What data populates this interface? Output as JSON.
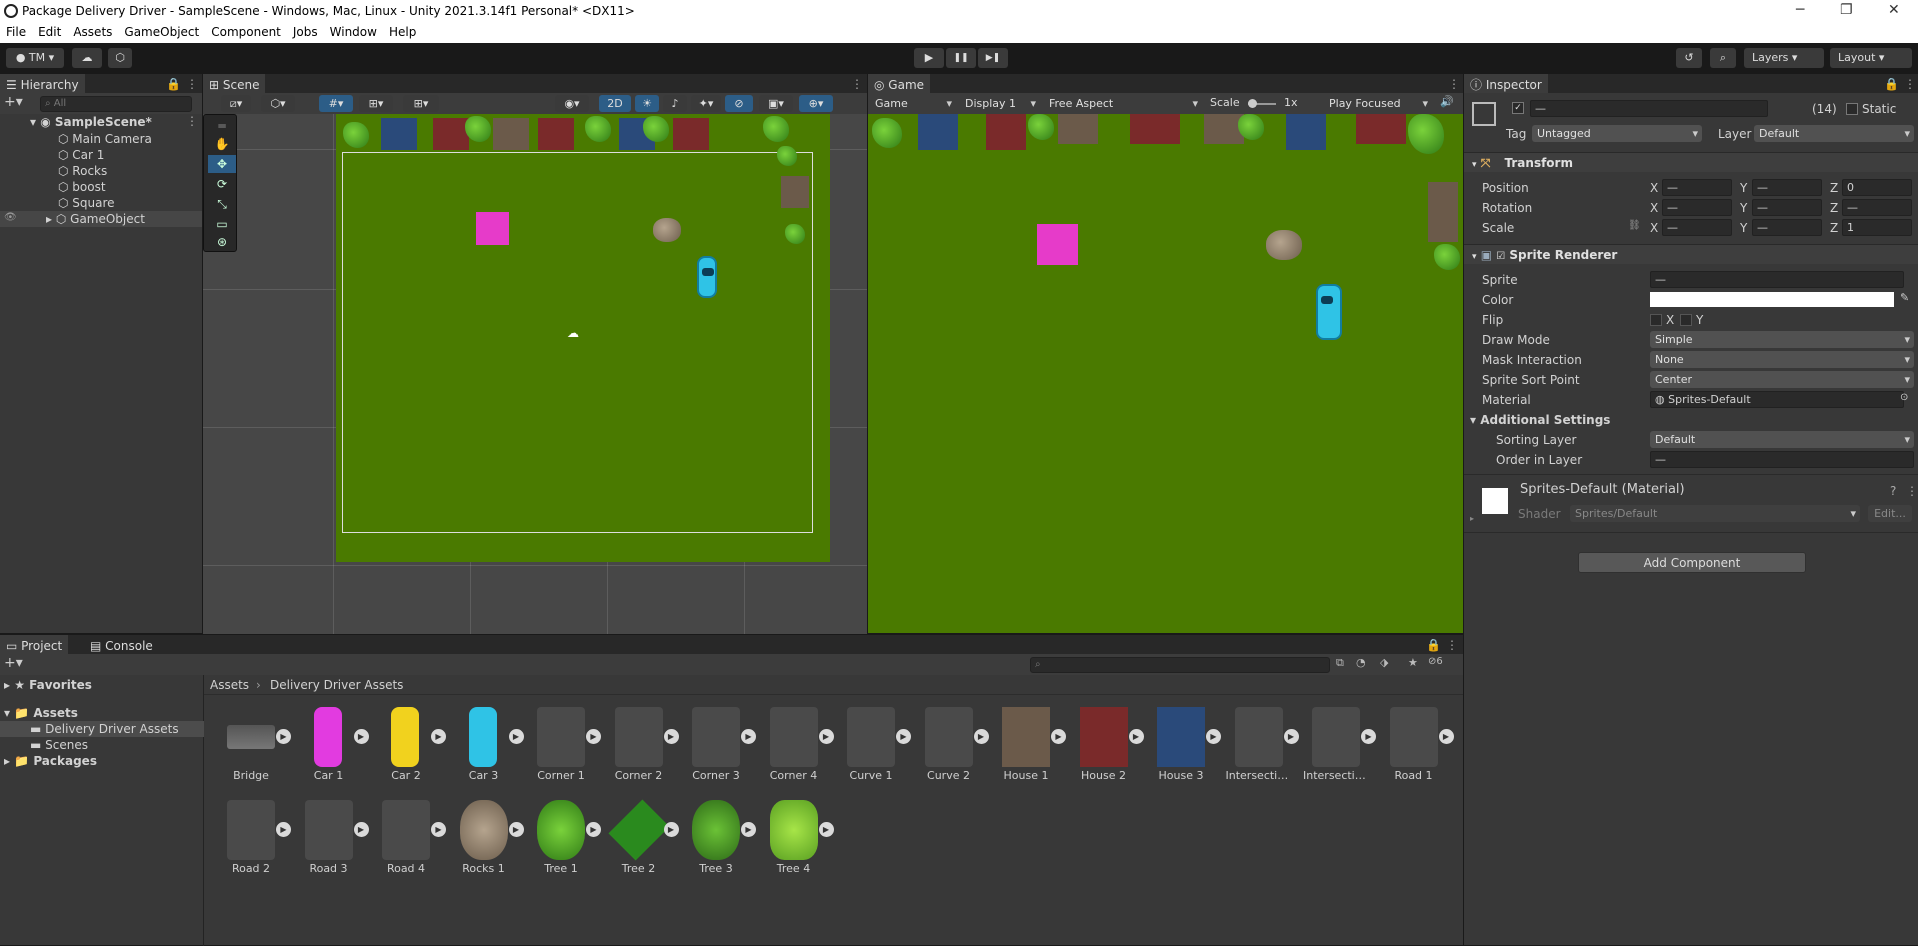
{
  "window": {
    "title": "Package Delivery Driver - SampleScene - Windows, Mac, Linux - Unity 2021.3.14f1 Personal* <DX11>",
    "minimize": "─",
    "maximize": "❐",
    "close": "✕"
  },
  "menu": [
    "File",
    "Edit",
    "Assets",
    "GameObject",
    "Component",
    "Jobs",
    "Window",
    "Help"
  ],
  "toolbar": {
    "account": "TM",
    "layers": "Layers",
    "layout": "Layout",
    "play": "▶",
    "pause": "❚❚",
    "step": "▶❚"
  },
  "hierarchy": {
    "tab": "Hierarchy",
    "search_placeholder": "All",
    "scene": "SampleScene*",
    "items": [
      "Main Camera",
      "Car 1",
      "Rocks",
      "boost",
      "Square",
      "GameObject"
    ]
  },
  "scene_view": {
    "tab": "Scene",
    "mode_2d": "2D"
  },
  "game_view": {
    "tab": "Game",
    "game": "Game",
    "display": "Display 1",
    "aspect": "Free Aspect",
    "scale_label": "Scale",
    "scale_value": "1x",
    "play_focused": "Play Focused"
  },
  "inspector": {
    "tab": "Inspector",
    "name_field": "—",
    "count": "(14)",
    "static": "Static",
    "tag_label": "Tag",
    "tag_value": "Untagged",
    "layer_label": "Layer",
    "layer_value": "Default",
    "transform": {
      "title": "Transform",
      "position": "Position",
      "rotation": "Rotation",
      "scale": "Scale",
      "x": "X",
      "y": "Y",
      "z": "Z",
      "dash": "—",
      "pos_z": "0",
      "scale_z": "1"
    },
    "sprite_renderer": {
      "title": "Sprite Renderer",
      "sprite": "Sprite",
      "sprite_value": "—",
      "color": "Color",
      "flip": "Flip",
      "flip_x": "X",
      "flip_y": "Y",
      "draw_mode": "Draw Mode",
      "draw_mode_value": "Simple",
      "mask_interaction": "Mask Interaction",
      "mask_interaction_value": "None",
      "sort_point": "Sprite Sort Point",
      "sort_point_value": "Center",
      "material": "Material",
      "material_value": "Sprites-Default",
      "additional": "Additional Settings",
      "sorting_layer": "Sorting Layer",
      "sorting_layer_value": "Default",
      "order_in_layer": "Order in Layer",
      "order_value": "—"
    },
    "material_block": {
      "title": "Sprites-Default (Material)",
      "shader_label": "Shader",
      "shader_value": "Sprites/Default",
      "edit": "Edit..."
    },
    "add_component": "Add Component"
  },
  "project": {
    "tab_project": "Project",
    "tab_console": "Console",
    "hidden_count": "6",
    "tree": {
      "favorites": "Favorites",
      "assets": "Assets",
      "folder1": "Delivery Driver Assets",
      "folder2": "Scenes",
      "packages": "Packages"
    },
    "breadcrumb": [
      "Assets",
      "Delivery Driver Assets"
    ],
    "assets_row1": [
      "Bridge",
      "Car 1",
      "Car 2",
      "Car 3",
      "Corner 1",
      "Corner 2",
      "Corner 3",
      "Corner 4",
      "Curve 1",
      "Curve 2",
      "House 1",
      "House 2",
      "House 3",
      "Intersectio...",
      "Intersectio...",
      "Road 1"
    ],
    "assets_row2": [
      "Road 2",
      "Road 3",
      "Road 4",
      "Rocks 1",
      "Tree 1",
      "Tree 2",
      "Tree 3",
      "Tree 4"
    ]
  },
  "colors": {
    "grass": "#4a7a00",
    "magenta": "#e63bc9",
    "car": "#2fc3e6",
    "panel": "#383838",
    "header": "#282828",
    "selection": "#2c5d87"
  }
}
